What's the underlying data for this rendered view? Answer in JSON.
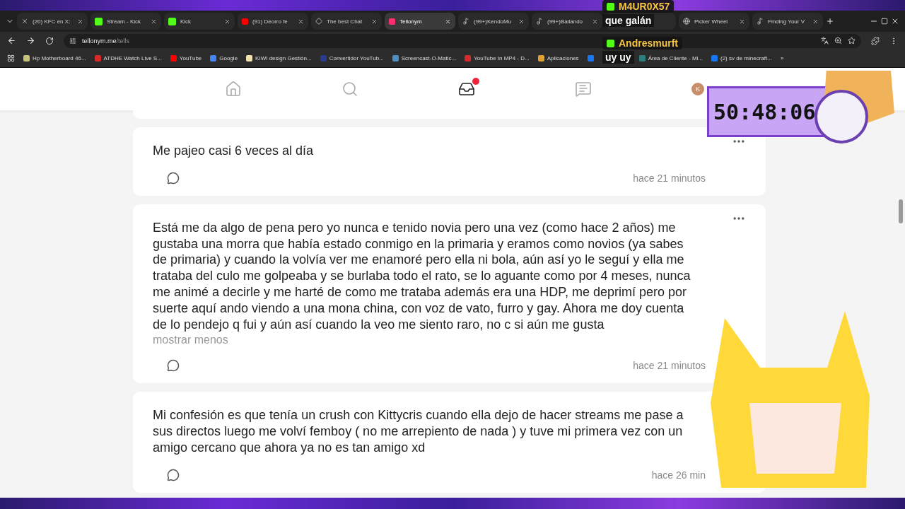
{
  "browser": {
    "tabs": [
      {
        "title": "(20) KFC en X:",
        "selected": false
      },
      {
        "title": "Stream - Kick",
        "selected": false
      },
      {
        "title": "Kick",
        "selected": false
      },
      {
        "title": "(91) Deorro fe",
        "selected": false
      },
      {
        "title": "The best Chat",
        "selected": false
      },
      {
        "title": "Tellonym",
        "selected": true
      },
      {
        "title": "(99+)KendoMu",
        "selected": false
      },
      {
        "title": "(99+)Bailando",
        "selected": false
      },
      {
        "title": "Picker Wheel",
        "selected": false
      },
      {
        "title": "Finding Your V",
        "selected": false
      }
    ],
    "address": {
      "host": "tellonym.me",
      "path": "/tells"
    },
    "bookmarks": [
      {
        "label": "Hp Motherboard 46..."
      },
      {
        "label": "ATDHE Watch Live S..."
      },
      {
        "label": "YouTube"
      },
      {
        "label": "Google"
      },
      {
        "label": "KIWI design Gestión..."
      },
      {
        "label": "Convertidor YouTub..."
      },
      {
        "label": "Screencast-O-Matic..."
      },
      {
        "label": "YouTube In MP4 - D..."
      },
      {
        "label": "Aplicaciones"
      },
      {
        "label": "Área de Cliente - Mi..."
      },
      {
        "label": "(2) sv de minecraft..."
      }
    ],
    "more": "»"
  },
  "nav": {
    "items": [
      {
        "kind": "home",
        "selected": false,
        "badge": false
      },
      {
        "kind": "search",
        "selected": false,
        "badge": false
      },
      {
        "kind": "inbox",
        "selected": true,
        "badge": true
      },
      {
        "kind": "chat",
        "selected": false,
        "badge": false
      }
    ],
    "avatar": "K"
  },
  "posts": [
    {
      "text": "Me pajeo casi 6 veces al día",
      "time": "hace 21 minutos"
    },
    {
      "text": "Está me da algo de pena pero yo nunca e tenido novia pero una vez (como hace 2 años) me gustaba una morra que había estado conmigo en la primaria y eramos como novios (ya sabes de primaria) y cuando la volvía ver me enamoré pero ella ni bola, aún así yo le seguí y ella me trataba del culo me golpeaba y se burlaba todo el rato, se lo aguante como por 4 meses, nunca me animé a decirle y me harté de como me trataba además era una HDP, me deprimí pero por suerte aquí ando viendo a una mona china, con voz de vato, furro y gay. Ahora me doy cuenta de lo pendejo q fui y aún así cuando la veo me siento raro, no c si aún me gusta",
      "toggle": "mostrar menos",
      "time": "hace 21 minutos"
    },
    {
      "text": "Mi confesión es que tenía un crush con Kittycris cuando ella dejo de hacer streams me pase a sus directos luego me volví femboy ( no me arrepiento de nada ) y tuve mi primera vez con un amigo cercano que ahora ya no es tan amigo xd",
      "time": "hace 26 min"
    }
  ],
  "overlay": {
    "chat": [
      {
        "user": "M4UR0X57",
        "message": "que galán"
      },
      {
        "user": "Andresmurft",
        "message": "uy uy"
      }
    ],
    "timer": "50:48:06"
  }
}
